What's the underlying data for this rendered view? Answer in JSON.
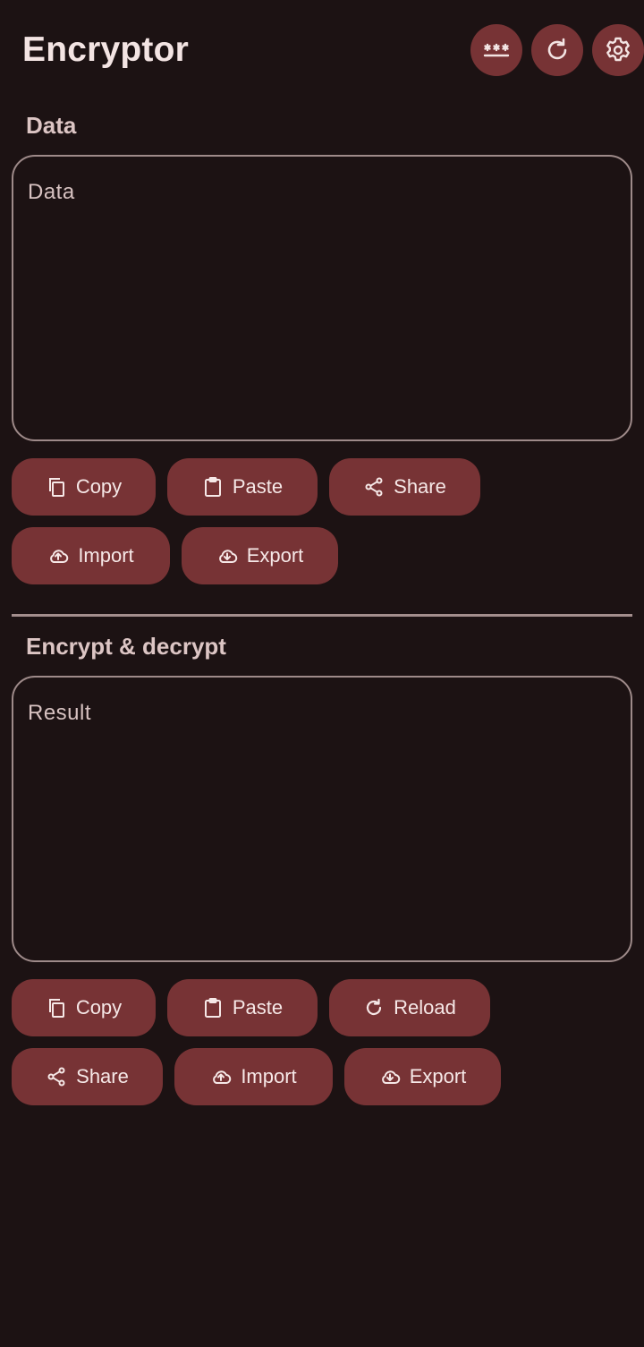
{
  "app": {
    "title": "Encryptor"
  },
  "toolbar": {
    "icons": [
      "password-icon",
      "refresh-icon",
      "settings-icon"
    ]
  },
  "data_section": {
    "title": "Data",
    "placeholder": "Data",
    "buttons": {
      "copy": "Copy",
      "paste": "Paste",
      "share": "Share",
      "import": "Import",
      "export": "Export"
    }
  },
  "result_section": {
    "title": "Encrypt & decrypt",
    "placeholder": "Result",
    "buttons": {
      "copy": "Copy",
      "paste": "Paste",
      "reload": "Reload",
      "share": "Share",
      "import": "Import",
      "export": "Export"
    }
  },
  "colors": {
    "background": "#1c1213",
    "button": "#773335",
    "text": "#f0dedd",
    "outline": "#9e8a89"
  }
}
